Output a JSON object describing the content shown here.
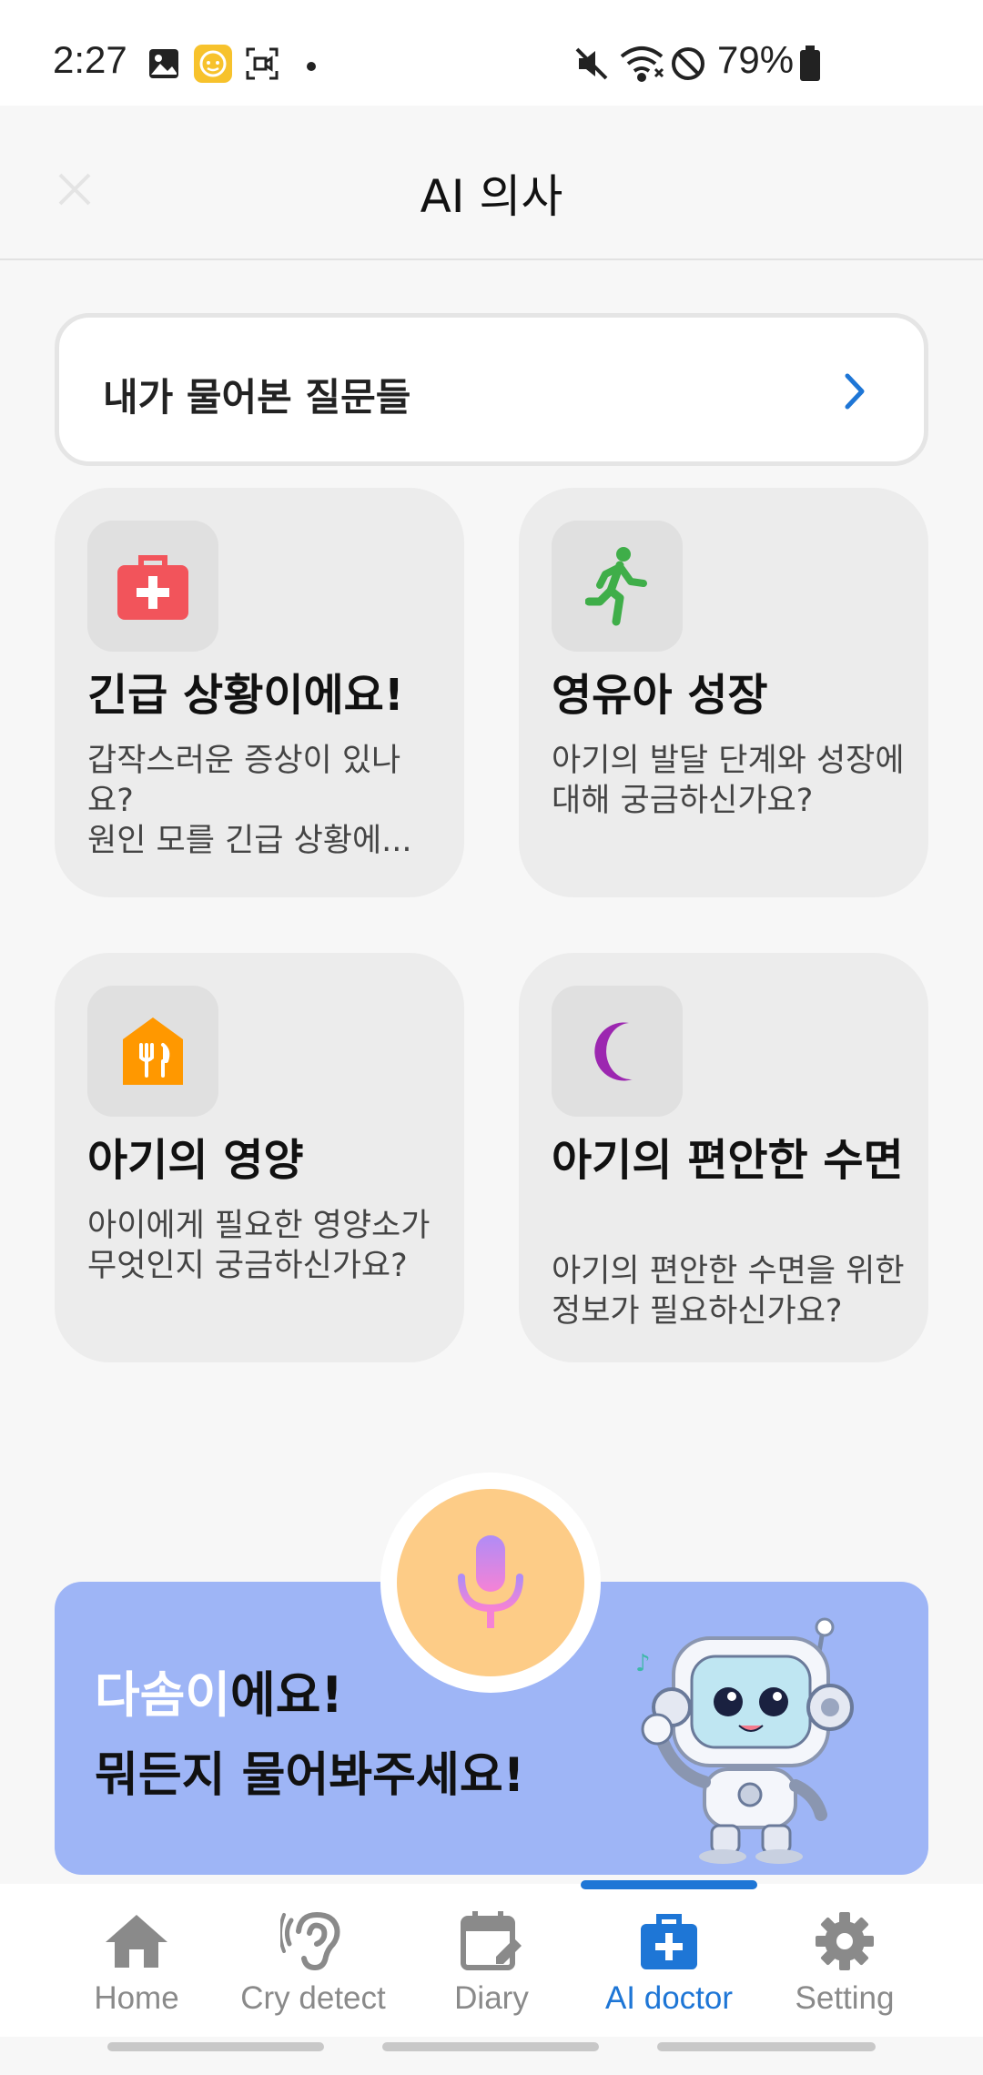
{
  "status_bar": {
    "time": "2:27",
    "battery": "79%",
    "icons": [
      "gallery-icon",
      "baby-app-icon",
      "screen-record-icon",
      "dot-icon",
      "mute-icon",
      "wifi-icon",
      "do-not-disturb-icon",
      "battery-icon"
    ]
  },
  "header": {
    "title": "AI 의사",
    "close_icon": "close-icon"
  },
  "questions": {
    "label": "내가 물어본 질문들",
    "icon": "chevron-right-icon"
  },
  "topics": [
    {
      "title": "긴급 상황이에요!",
      "desc": "갑작스러운 증상이 있나요?\n원인 모를 긴급 상황에...",
      "icon": "first-aid-kit-icon",
      "color": "#f2545b"
    },
    {
      "title": "영유아 성장",
      "desc": "아기의 발달 단계와 성장에 대해 궁금하신가요?",
      "icon": "running-person-icon",
      "color": "#3fae49"
    },
    {
      "title": "아기의 영양",
      "desc": "아이에게 필요한 영양소가 무엇인지 궁금하신가요?",
      "icon": "restaurant-icon",
      "color": "#ff9800"
    },
    {
      "title": "아기의 편안한 수면",
      "desc": "아기의 편안한 수면을 위한 정보가 필요하신가요?",
      "icon": "moon-icon",
      "color": "#9c27b0"
    }
  ],
  "banner": {
    "name": "다솜이",
    "line1_suffix": "에요!",
    "line2": "뭐든지 물어봐주세요!",
    "mic_icon": "microphone-icon",
    "mascot": "robot-mascot"
  },
  "nav": {
    "items": [
      {
        "label": "Home",
        "icon": "home-icon"
      },
      {
        "label": "Cry detect",
        "icon": "ear-icon"
      },
      {
        "label": "Diary",
        "icon": "calendar-edit-icon"
      },
      {
        "label": "AI doctor",
        "icon": "medical-bag-icon",
        "active": true
      },
      {
        "label": "Setting",
        "icon": "gear-icon"
      }
    ],
    "active_color": "#1e76d6"
  }
}
